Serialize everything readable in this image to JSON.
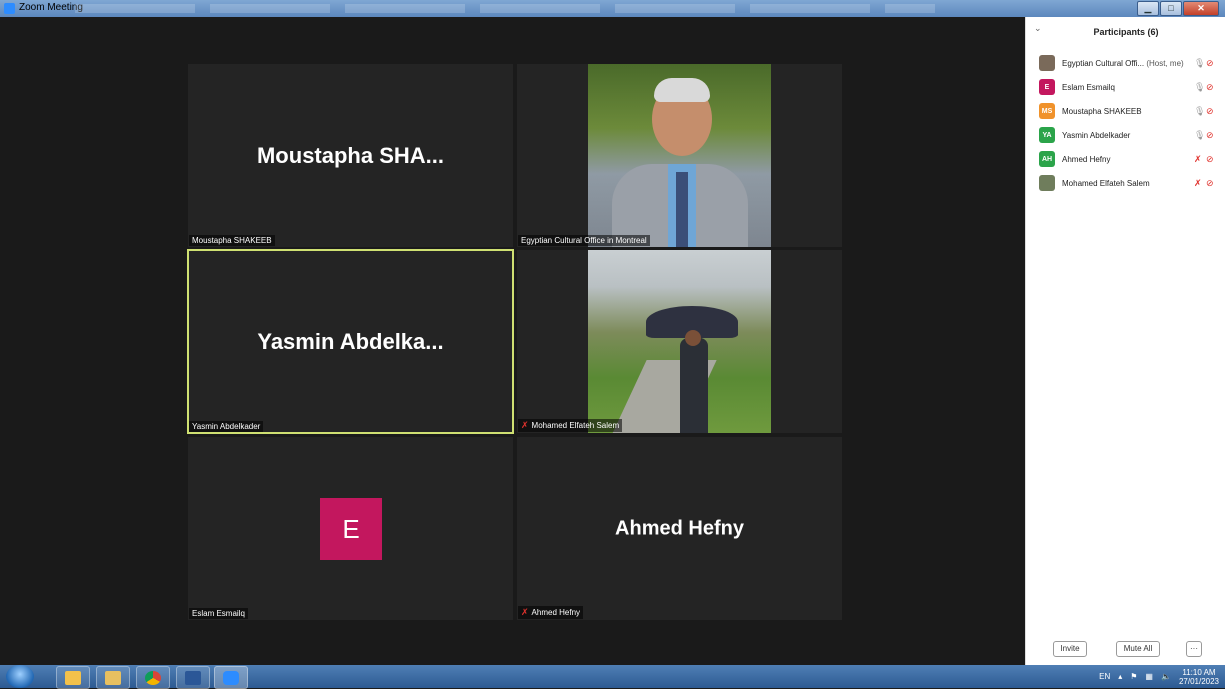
{
  "window": {
    "title": "Zoom Meeting"
  },
  "tiles": [
    {
      "id": "moustapha",
      "big_name": "Moustapha  SHA...",
      "label": "Moustapha SHAKEEB",
      "muted": false,
      "active": false
    },
    {
      "id": "egyptian",
      "big_name": "",
      "label": "Egyptian Cultural Office in Montreal",
      "muted": false,
      "active": false
    },
    {
      "id": "yasmin",
      "big_name": "Yasmin  Abdelka...",
      "label": "Yasmin Abdelkader",
      "muted": false,
      "active": true
    },
    {
      "id": "mohamed",
      "big_name": "",
      "label": "Mohamed Elfateh Salem",
      "muted": true,
      "active": false
    },
    {
      "id": "eslam",
      "avatar_letter": "E",
      "label": "Eslam Esmailq",
      "muted": false,
      "active": false
    },
    {
      "id": "ahmed",
      "big_name": "Ahmed Hefny",
      "label": "Ahmed Hefny",
      "muted": true,
      "active": false
    }
  ],
  "participants_panel": {
    "title": "Participants (6)",
    "items": [
      {
        "initials": "",
        "name": "Egyptian Cultural Offi...",
        "suffix": " (Host, me)",
        "avatar_color": "#7a6a5a",
        "mic_muted": false,
        "video_off": true
      },
      {
        "initials": "E",
        "name": "Eslam Esmailq",
        "suffix": "",
        "avatar_color": "#c3175e",
        "mic_muted": false,
        "video_off": true
      },
      {
        "initials": "MS",
        "name": "Moustapha SHAKEEB",
        "suffix": "",
        "avatar_color": "#f0922b",
        "mic_muted": false,
        "video_off": true
      },
      {
        "initials": "YA",
        "name": "Yasmin Abdelkader",
        "suffix": "",
        "avatar_color": "#2ba44a",
        "mic_muted": false,
        "video_off": true
      },
      {
        "initials": "AH",
        "name": "Ahmed Hefny",
        "suffix": "",
        "avatar_color": "#2ba44a",
        "mic_muted": true,
        "video_off": true
      },
      {
        "initials": "",
        "name": "Mohamed Elfateh Salem",
        "suffix": "",
        "avatar_color": "#6f7d5c",
        "mic_muted": true,
        "video_off": true
      }
    ],
    "invite_label": "Invite",
    "mute_all_label": "Mute All",
    "more_label": "···"
  },
  "taskbar": {
    "language": "EN",
    "time": "11:10 AM",
    "date": "27/01/2023"
  },
  "icons": {
    "mic": "🎙",
    "mic_muted": "✗",
    "video_off": "⊘"
  }
}
